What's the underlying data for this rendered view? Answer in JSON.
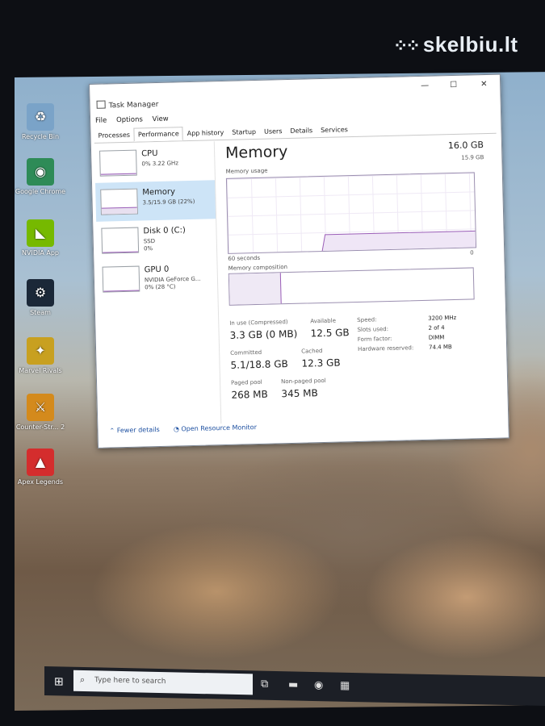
{
  "watermark": {
    "text": "skelbiu.lt",
    "dots_icon": "dots-logo-icon"
  },
  "desktop_icons": [
    {
      "label": "Recycle Bin",
      "icon": "recycle-bin-icon",
      "color": "#7aa3c8",
      "glyph": "♻"
    },
    {
      "label": "Google Chrome",
      "icon": "chrome-icon",
      "color": "#2e8b57",
      "glyph": "◉"
    },
    {
      "label": "NVIDIA App",
      "icon": "nvidia-icon",
      "color": "#76b900",
      "glyph": "◣"
    },
    {
      "label": "Steam",
      "icon": "steam-icon",
      "color": "#1b2838",
      "glyph": "⚙"
    },
    {
      "label": "Marvel Rivals",
      "icon": "marvel-rivals-icon",
      "color": "#c8a020",
      "glyph": "✦"
    },
    {
      "label": "Counter-Str... 2",
      "icon": "counter-strike-icon",
      "color": "#d48a1c",
      "glyph": "⚔"
    },
    {
      "label": "Apex Legends",
      "icon": "apex-legends-icon",
      "color": "#d42d2d",
      "glyph": "▲"
    }
  ],
  "window": {
    "title": "Task Manager",
    "controls": {
      "minimize": "—",
      "maximize": "☐",
      "close": "✕"
    },
    "menu": [
      "File",
      "Options",
      "View"
    ],
    "tabs": [
      "Processes",
      "Performance",
      "App history",
      "Startup",
      "Users",
      "Details",
      "Services"
    ],
    "active_tab": "Performance"
  },
  "sidebar": [
    {
      "name": "CPU",
      "line1": "0% 3.22 GHz",
      "line2": "",
      "fill": 0.02
    },
    {
      "name": "Memory",
      "line1": "3.5/15.9 GB (22%)",
      "line2": "",
      "fill": 0.22,
      "active": true
    },
    {
      "name": "Disk 0 (C:)",
      "line1": "SSD",
      "line2": "0%",
      "fill": 0.0
    },
    {
      "name": "GPU 0",
      "line1": "NVIDIA GeForce G...",
      "line2": "0% (28 °C)",
      "fill": 0.0
    }
  ],
  "memory": {
    "title": "Memory",
    "total": "16.0 GB",
    "usable": "15.9 GB",
    "usage_label": "Memory usage",
    "graph_left": "60 seconds",
    "graph_right": "0",
    "composition_label": "Memory composition",
    "in_use_fraction": 0.21,
    "stats": [
      {
        "label": "In use (Compressed)",
        "value": "3.3 GB (0 MB)"
      },
      {
        "label": "Available",
        "value": "12.5 GB"
      },
      {
        "label": "Committed",
        "value": "5.1/18.8 GB"
      },
      {
        "label": "Cached",
        "value": "12.3 GB"
      },
      {
        "label": "Paged pool",
        "value": "268 MB"
      },
      {
        "label": "Non-paged pool",
        "value": "345 MB"
      }
    ],
    "specs": [
      {
        "label": "Speed:",
        "value": "3200 MHz"
      },
      {
        "label": "Slots used:",
        "value": "2 of 4"
      },
      {
        "label": "Form factor:",
        "value": "DIMM"
      },
      {
        "label": "Hardware reserved:",
        "value": "74.4 MB"
      }
    ]
  },
  "footer": {
    "fewer_details": "Fewer details",
    "open_monitor": "Open Resource Monitor"
  },
  "taskbar": {
    "search_placeholder": "Type here to search"
  }
}
